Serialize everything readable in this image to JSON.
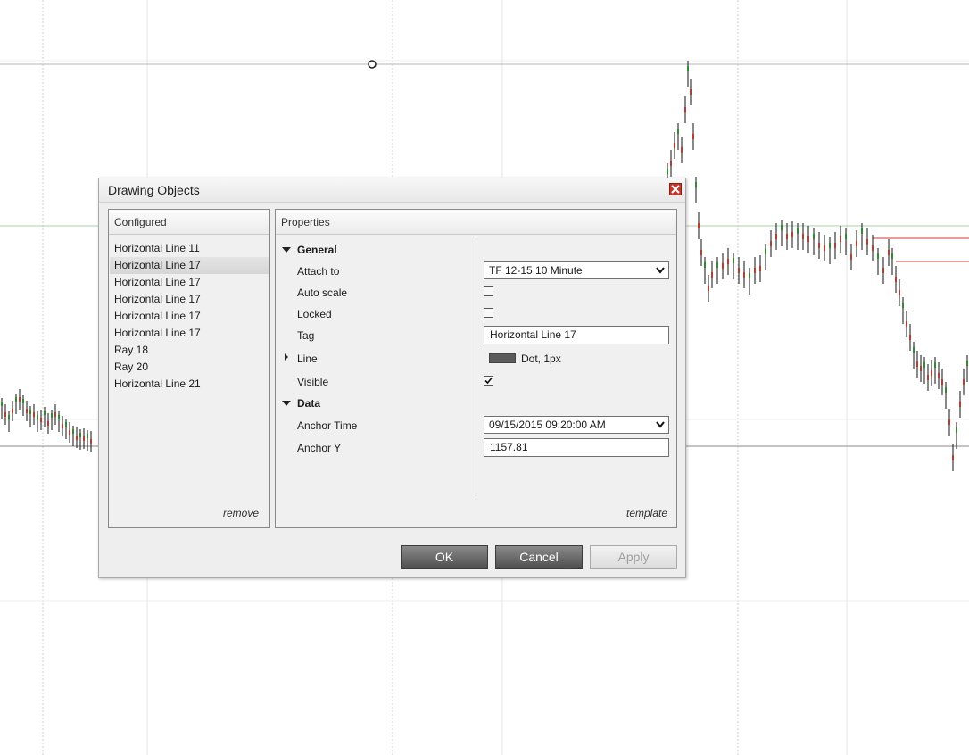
{
  "dialog": {
    "title": "Drawing Objects",
    "configured_header": "Configured",
    "properties_header": "Properties",
    "configured_items": [
      "Horizontal Line 11",
      "Horizontal Line 17",
      "Horizontal Line 17",
      "Horizontal Line 17",
      "Horizontal Line 17",
      "Horizontal Line 17",
      "Ray 18",
      "Ray 20",
      "Horizontal Line 21"
    ],
    "selected_index": 1,
    "remove_label": "remove",
    "template_label": "template",
    "properties": {
      "general_label": "General",
      "attach_to_label": "Attach to",
      "attach_to_value": "TF 12-15 10 Minute",
      "auto_scale_label": "Auto scale",
      "auto_scale_checked": false,
      "locked_label": "Locked",
      "locked_checked": false,
      "tag_label": "Tag",
      "tag_value": "Horizontal Line 17",
      "line_label": "Line",
      "line_value": "Dot, 1px",
      "visible_label": "Visible",
      "visible_checked": true,
      "data_label": "Data",
      "anchor_time_label": "Anchor Time",
      "anchor_time_value": "09/15/2015 09:20:00 AM",
      "anchor_y_label": "Anchor Y",
      "anchor_y_value": "1157.81"
    },
    "buttons": {
      "ok": "OK",
      "cancel": "Cancel",
      "apply": "Apply"
    }
  },
  "colors": {
    "up_candle": "#2e8b2e",
    "down_candle": "#c0392b",
    "close_button": "#c0392b",
    "accent_dark_button": "#5a5a5a"
  }
}
